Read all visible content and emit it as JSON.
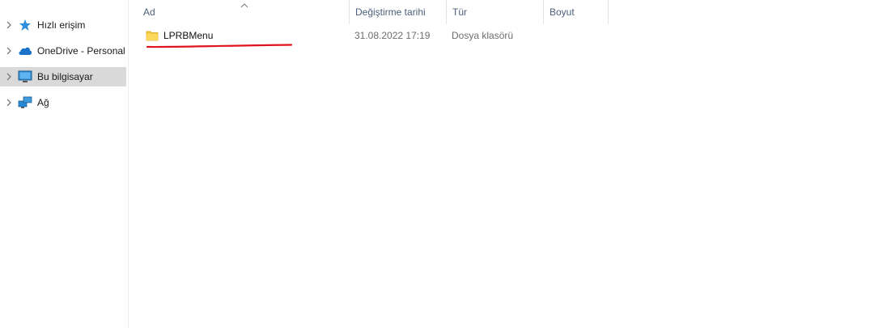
{
  "nav": {
    "items": [
      {
        "label": "Hızlı erişim",
        "icon": "star-icon"
      },
      {
        "label": "OneDrive - Personal",
        "icon": "cloud-icon"
      },
      {
        "label": "Bu bilgisayar",
        "icon": "computer-icon",
        "selected": true
      },
      {
        "label": "Ağ",
        "icon": "network-icon"
      }
    ]
  },
  "columns": {
    "name": "Ad",
    "date": "Değiştirme tarihi",
    "type": "Tür",
    "size": "Boyut"
  },
  "files": [
    {
      "name": "LPRBMenu",
      "date": "31.08.2022 17:19",
      "type": "Dosya klasörü",
      "size": ""
    }
  ],
  "colors": {
    "selected_bg": "#d9d9d9",
    "header_text": "#4c607a",
    "annotation": "#e0141e",
    "folder": "#f5c842"
  }
}
